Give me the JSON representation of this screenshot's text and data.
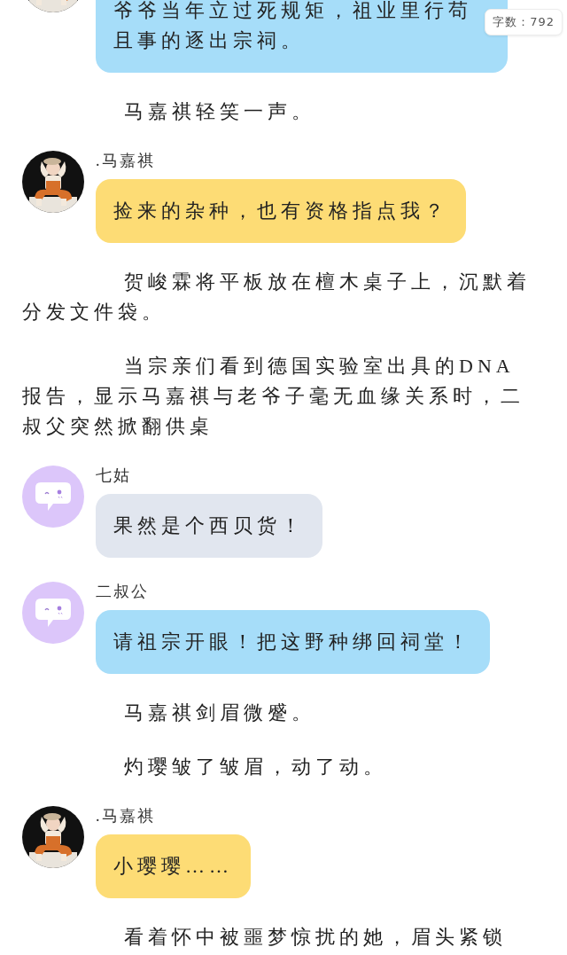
{
  "word_count": "字数：792",
  "messages": [
    {
      "kind": "chat",
      "color": "#a6ddf9",
      "text": "爷爷当年立过死规矩，祖业里行苟且事的逐出宗祠。"
    },
    {
      "kind": "narration",
      "text": "马嘉祺轻笑一声。"
    },
    {
      "kind": "chat",
      "speaker": ".马嘉祺",
      "color": "#fddc75",
      "text": "捡来的杂种，也有资格指点我？"
    },
    {
      "kind": "narration",
      "text": "贺峻霖将平板放在檀木桌子上，沉默着分发文件袋。"
    },
    {
      "kind": "narration",
      "text": "当宗亲们看到德国实验室出具的DNA报告，显示马嘉祺与老爷子毫无血缘关系时，二叔父突然掀翻供桌"
    },
    {
      "kind": "chat",
      "speaker": "七姑",
      "avatar": {
        "kind": "icon"
      },
      "color": "#e1e6ef",
      "text": "果然是个西贝货！"
    },
    {
      "kind": "chat",
      "speaker": "二叔公",
      "avatar": {
        "kind": "icon"
      },
      "color": "#a6ddf9",
      "text": "请祖宗开眼！把这野种绑回祠堂！"
    },
    {
      "kind": "narration",
      "text": "马嘉祺剑眉微蹙。"
    },
    {
      "kind": "narration",
      "text": "灼璎皱了皱眉，动了动。"
    },
    {
      "kind": "chat",
      "speaker": ".马嘉祺",
      "color": "#fddc75",
      "text": "小璎璎……"
    },
    {
      "kind": "narration",
      "text": "看着怀中被噩梦惊扰的她，眉头紧锁"
    }
  ]
}
